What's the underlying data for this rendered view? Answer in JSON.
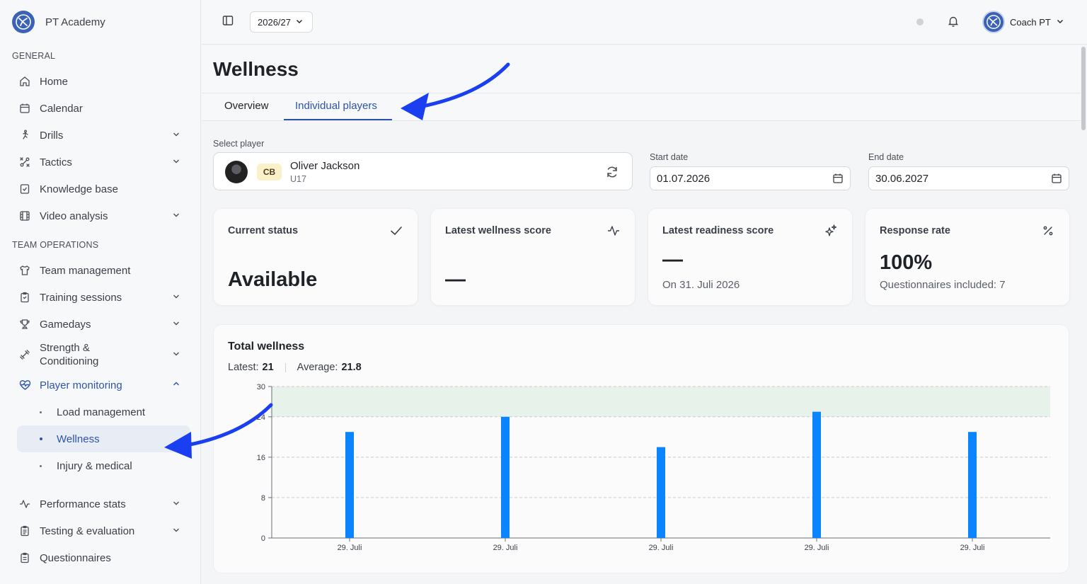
{
  "app": {
    "name": "PT Academy"
  },
  "sidebar": {
    "sections": [
      {
        "label": "GENERAL"
      },
      {
        "label": "TEAM OPERATIONS"
      }
    ],
    "items": [
      {
        "label": "Home",
        "icon": "home-icon"
      },
      {
        "label": "Calendar",
        "icon": "calendar-icon"
      },
      {
        "label": "Drills",
        "icon": "running-figure-icon"
      },
      {
        "label": "Tactics",
        "icon": "tactics-icon"
      },
      {
        "label": "Knowledge base",
        "icon": "book-check-icon"
      },
      {
        "label": "Video analysis",
        "icon": "film-icon"
      },
      {
        "label": "Team management",
        "icon": "shirt-icon"
      },
      {
        "label": "Training sessions",
        "icon": "clipboard-icon"
      },
      {
        "label": "Gamedays",
        "icon": "trophy-icon"
      },
      {
        "label": "Strength & Conditioning",
        "icon": "dumbbell-icon"
      },
      {
        "label": "Player monitoring",
        "icon": "heart-pulse-icon"
      },
      {
        "label": "Performance stats",
        "icon": "activity-icon"
      },
      {
        "label": "Testing & evaluation",
        "icon": "clipboard-list-icon"
      },
      {
        "label": "Questionnaires",
        "icon": "clipboard-text-icon"
      }
    ],
    "sub_items": [
      {
        "label": "Load management"
      },
      {
        "label": "Wellness",
        "active": true
      },
      {
        "label": "Injury & medical"
      }
    ]
  },
  "topbar": {
    "season": "2026/27",
    "user": "Coach PT"
  },
  "page": {
    "title": "Wellness",
    "tabs": [
      {
        "label": "Overview"
      },
      {
        "label": "Individual players",
        "active": true
      }
    ]
  },
  "filters": {
    "player_label": "Select player",
    "player_name": "Oliver Jackson",
    "player_team": "U17",
    "player_position": "CB",
    "start_label": "Start date",
    "start_value": "01.07.2026",
    "end_label": "End date",
    "end_value": "30.06.2027"
  },
  "cards": [
    {
      "title": "Current status",
      "value": "Available",
      "icon": "check-icon"
    },
    {
      "title": "Latest wellness score",
      "value": "—",
      "icon": "activity-icon"
    },
    {
      "title": "Latest readiness score",
      "value": "—",
      "sub": "On 31. Juli 2026",
      "icon": "sparkles-icon"
    },
    {
      "title": "Response rate",
      "value": "100%",
      "sub": "Questionnaires included: 7",
      "icon": "percent-icon"
    }
  ],
  "chart": {
    "title": "Total wellness",
    "latest_label": "Latest:",
    "latest_value": "21",
    "average_label": "Average:",
    "average_value": "21.8"
  },
  "chart_data": {
    "type": "bar",
    "categories": [
      "29. Juli",
      "29. Juli",
      "29. Juli",
      "29. Juli",
      "29. Juli"
    ],
    "values": [
      21,
      24,
      18,
      25,
      21
    ],
    "ylim": [
      0,
      30
    ],
    "yticks": [
      "0",
      "8",
      "16",
      "24",
      "30"
    ],
    "band": [
      24,
      30
    ],
    "bar_color": "#0a84ff",
    "band_color": "#e6f2ea",
    "grid": true
  },
  "colors": {
    "accent": "#2d54a8",
    "annotation_arrow": "#1a3ff0"
  }
}
